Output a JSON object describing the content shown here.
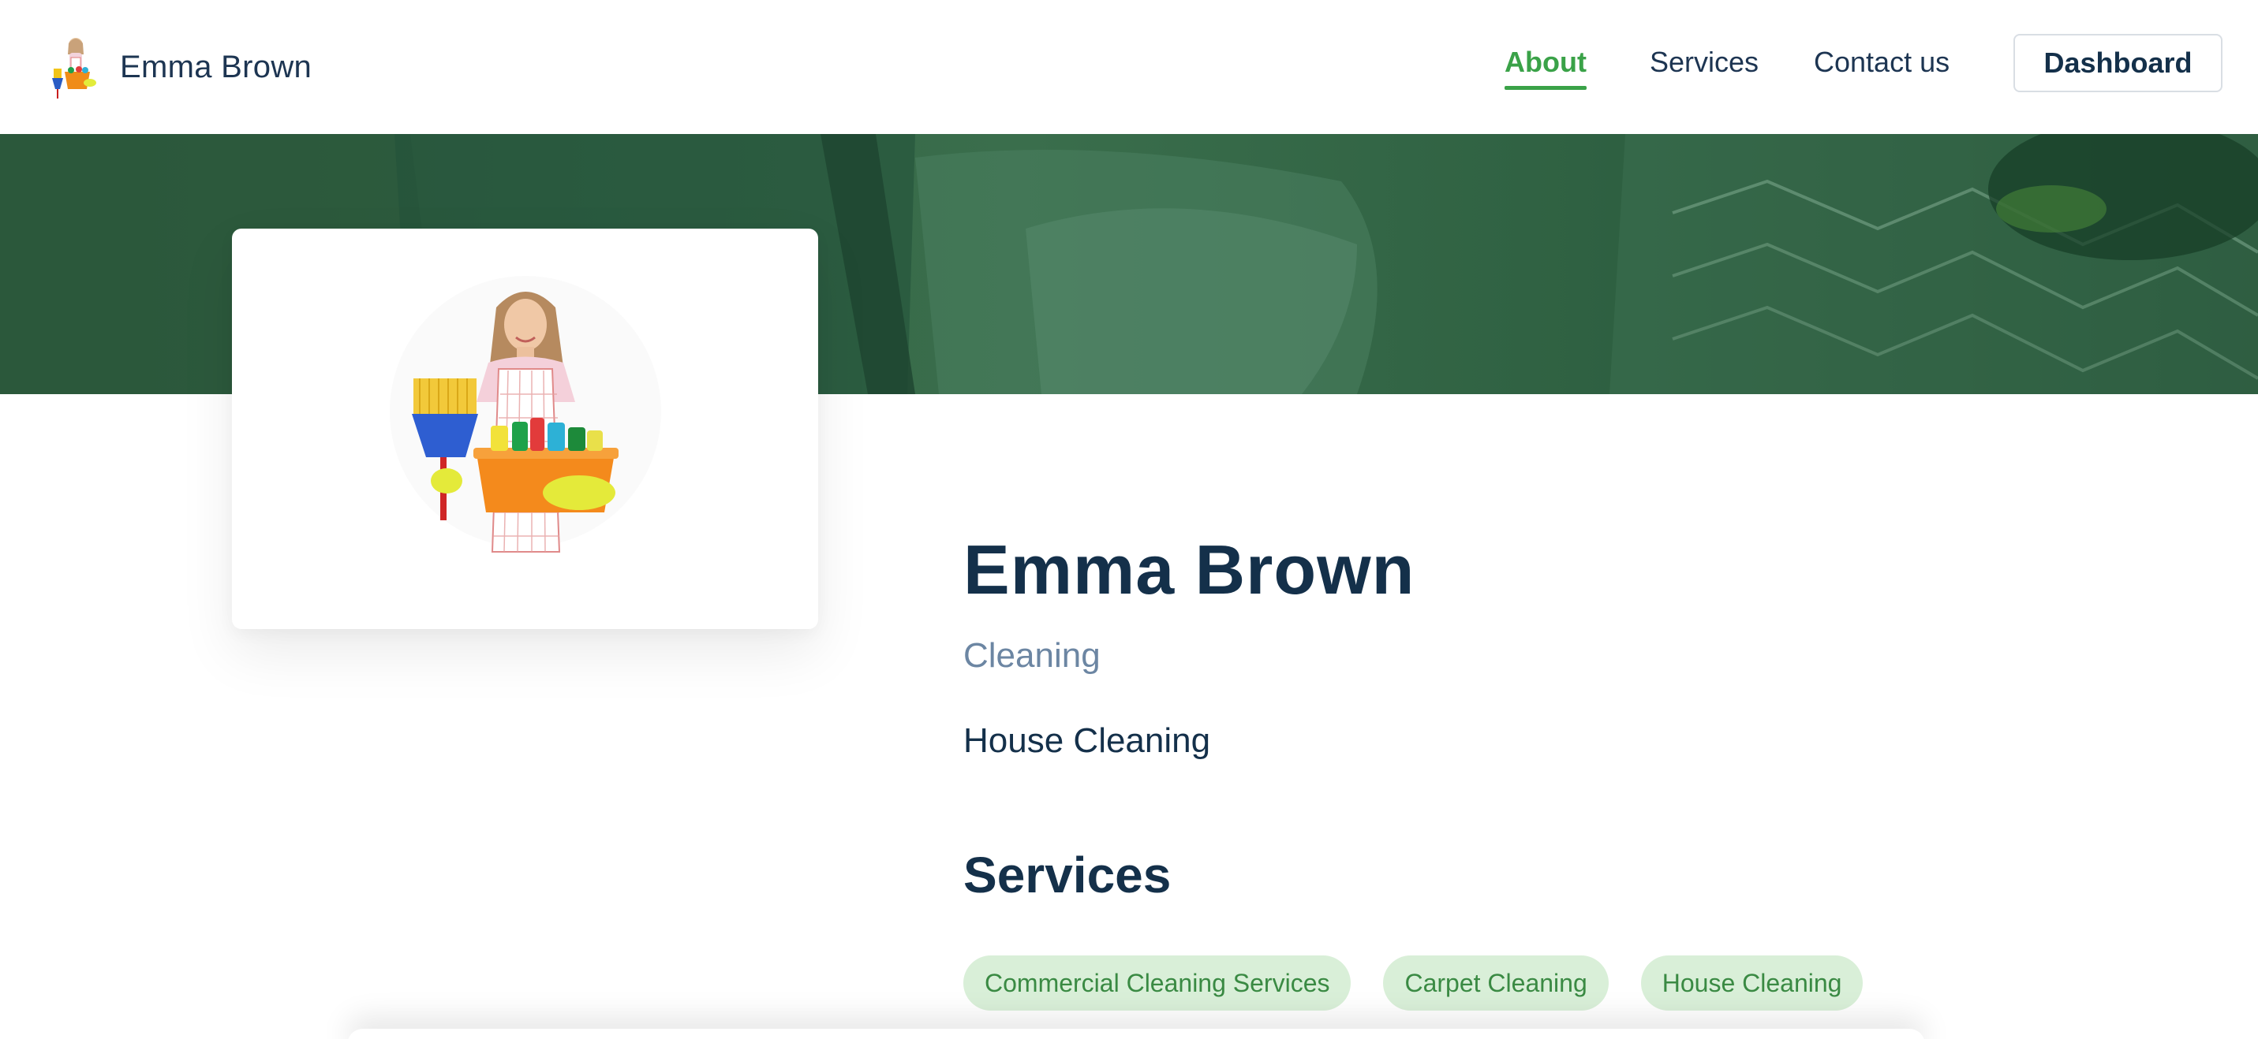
{
  "header": {
    "brand_name": "Emma Brown",
    "nav": [
      {
        "label": "About",
        "active": true
      },
      {
        "label": "Services",
        "active": false
      },
      {
        "label": "Contact us",
        "active": false
      }
    ],
    "dashboard_label": "Dashboard"
  },
  "profile": {
    "name": "Emma Brown",
    "category": "Cleaning",
    "subcategory": "House Cleaning"
  },
  "services": {
    "heading": "Services",
    "tags": [
      "Commercial Cleaning Services",
      "Carpet Cleaning",
      "House Cleaning"
    ]
  },
  "colors": {
    "accent_green": "#3aa248",
    "tag_background": "#d9efd8",
    "tag_text": "#3a8a43",
    "heading_navy": "#14304a",
    "category_slate": "#6c86a3",
    "banner_green": "#2f5b40"
  }
}
